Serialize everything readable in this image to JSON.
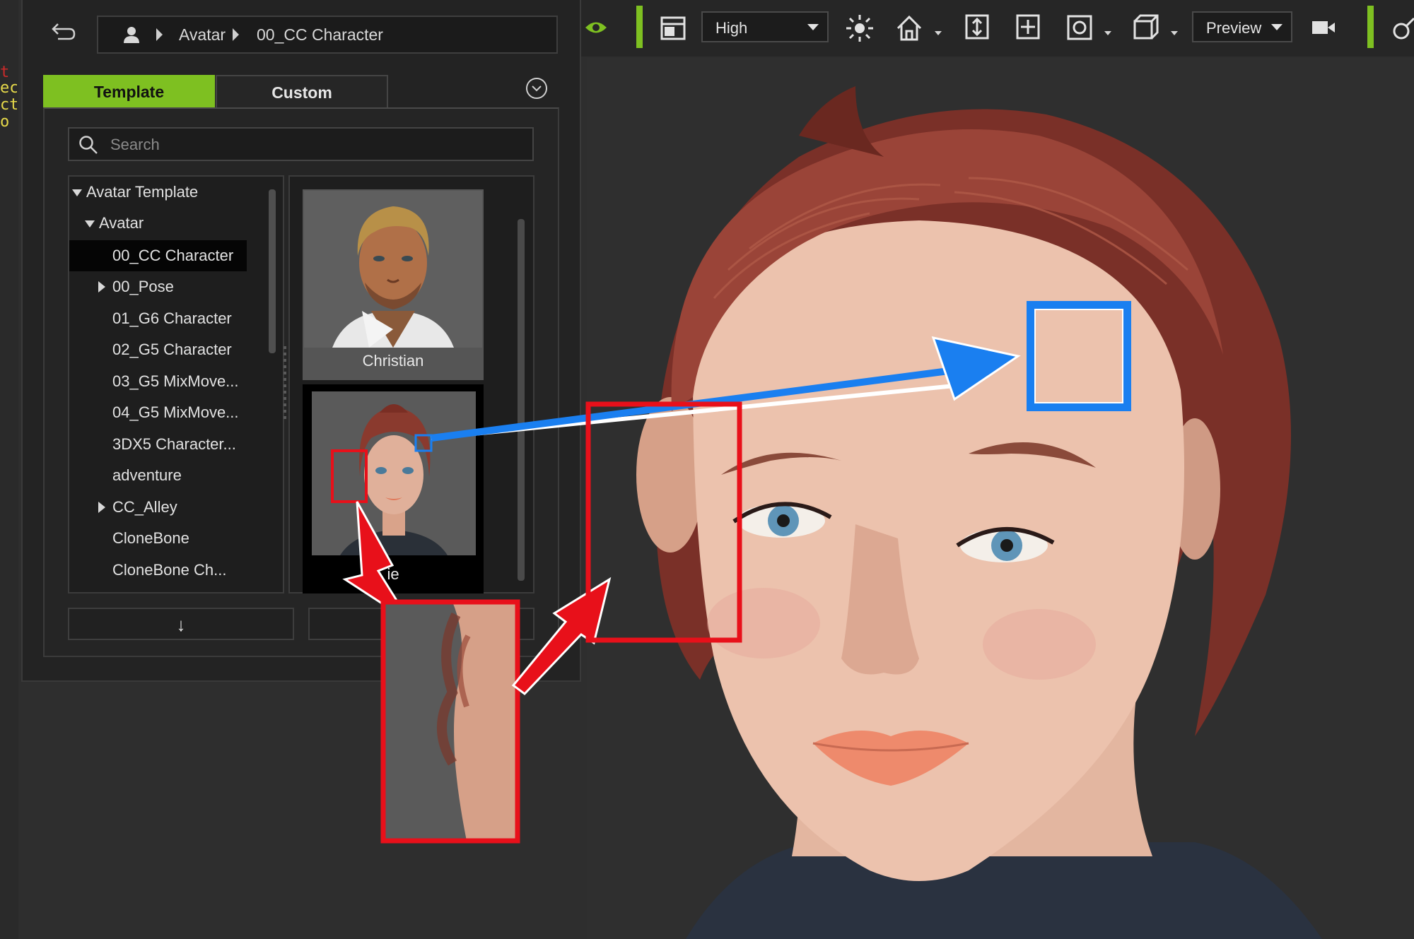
{
  "left_strip": {
    "lines": [
      "t I",
      "ec",
      "cte",
      "o I"
    ],
    "colors": [
      "#cc2b2b",
      "#e6d94a",
      "#e6d94a",
      "#e6d94a"
    ]
  },
  "breadcrumb": {
    "items": [
      "Avatar",
      "00_CC Character"
    ]
  },
  "tabs": [
    {
      "label": "Template",
      "active": true
    },
    {
      "label": "Custom",
      "active": false
    }
  ],
  "search": {
    "placeholder": "Search"
  },
  "tree": {
    "root": "Avatar Template",
    "folder": "Avatar",
    "items": [
      {
        "label": "00_CC Character",
        "selected": true,
        "expandable": false
      },
      {
        "label": "00_Pose",
        "selected": false,
        "expandable": true
      },
      {
        "label": "01_G6 Character",
        "selected": false,
        "expandable": false
      },
      {
        "label": "02_G5 Character",
        "selected": false,
        "expandable": false
      },
      {
        "label": "03_G5 MixMove...",
        "selected": false,
        "expandable": false
      },
      {
        "label": "04_G5 MixMove...",
        "selected": false,
        "expandable": false
      },
      {
        "label": "3DX5 Character...",
        "selected": false,
        "expandable": false
      },
      {
        "label": "adventure",
        "selected": false,
        "expandable": false
      },
      {
        "label": "CC_Alley",
        "selected": false,
        "expandable": true
      },
      {
        "label": "CloneBone",
        "selected": false,
        "expandable": false
      },
      {
        "label": "CloneBone Ch...",
        "selected": false,
        "expandable": false
      }
    ]
  },
  "thumbnails": [
    {
      "label": "Christian",
      "selected": false
    },
    {
      "label": "ie",
      "selected": true
    }
  ],
  "bottom": {
    "down_label": "↓"
  },
  "toolbar": {
    "quality": "High",
    "preview": "Preview"
  },
  "icons": [
    "back-arrow-icon",
    "user-icon",
    "search-icon",
    "collapse-icon",
    "eye-icon",
    "layout-icon",
    "light-icon",
    "home-icon",
    "fit-vertical-icon",
    "move-icon",
    "rotate-icon",
    "box-icon",
    "camera-icon"
  ],
  "colors": {
    "accent": "#7ec021",
    "callout_red": "#e8101a",
    "callout_blue": "#1a7ff0"
  }
}
